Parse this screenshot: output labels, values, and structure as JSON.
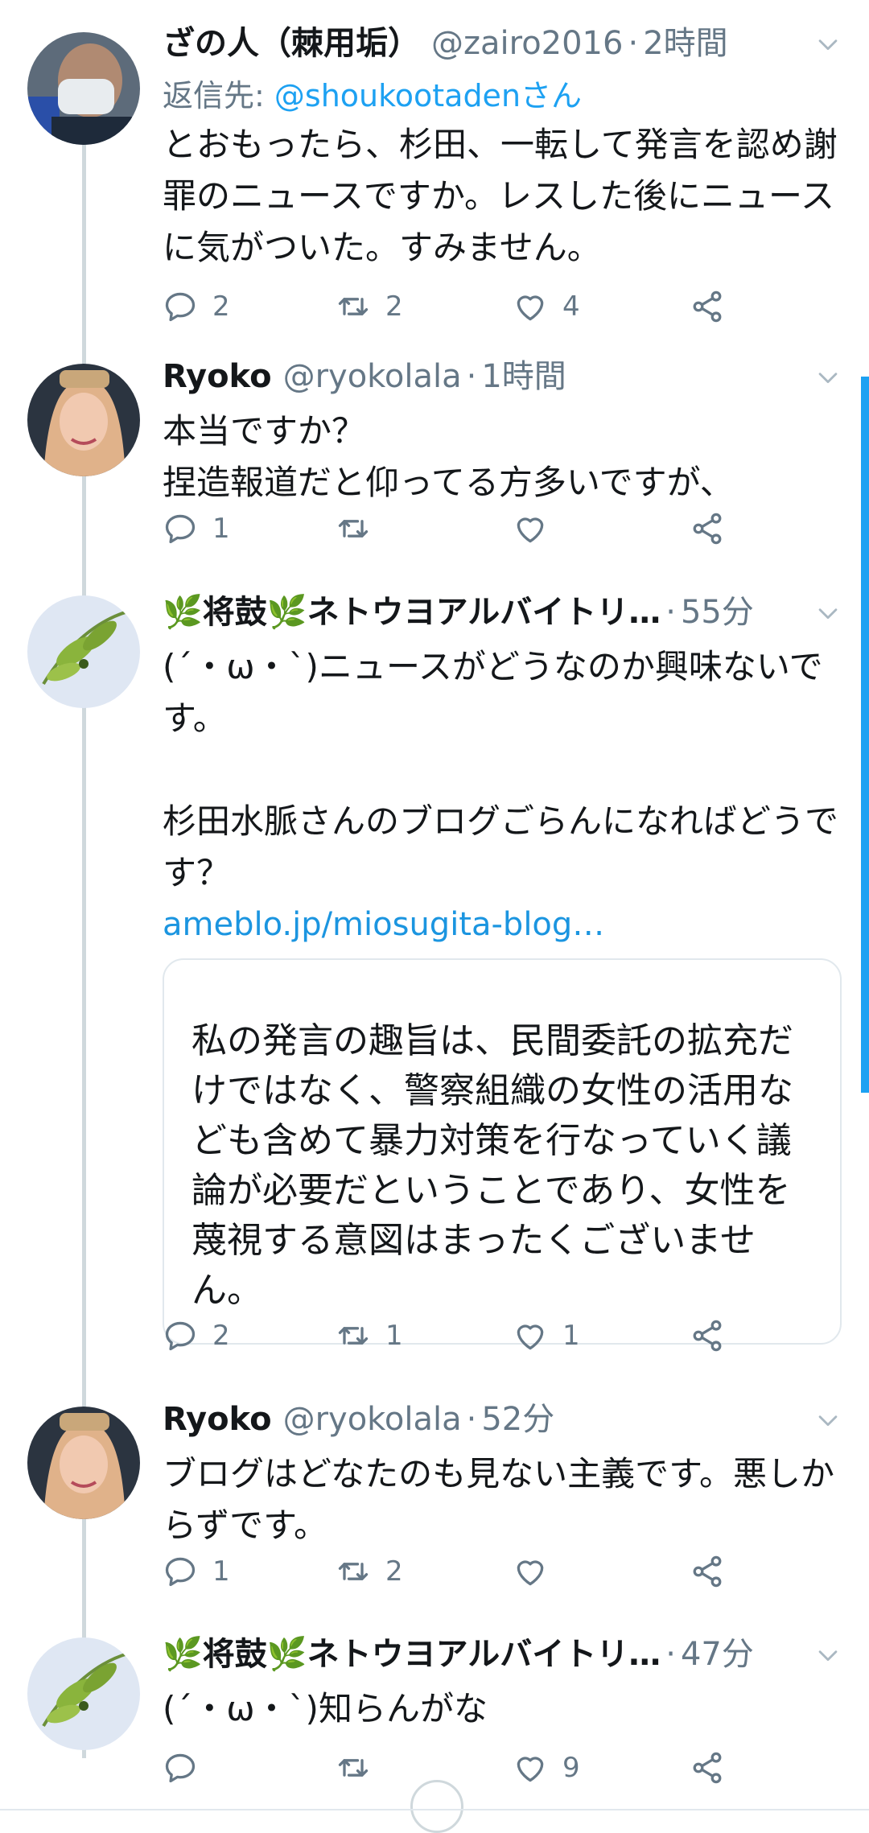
{
  "tweets": [
    {
      "name": "ざの人（棘用垢）",
      "handle": "@zairo2016",
      "time": "2時間",
      "reply_to_label": "返信先: ",
      "reply_to_user": "@shoukootadenさん",
      "text": "とおもったら、杉田、一転して発言を認め謝\n罪のニュースですか。レスした後にニュース\nに気がついた。すみません。",
      "replies": "2",
      "retweets": "2",
      "likes": "4"
    },
    {
      "name": "Ryoko",
      "handle": "@ryokolala",
      "time": "1時間",
      "text": "本当ですか？\n捏造報道だと仰ってる方多いですが、",
      "replies": "1",
      "retweets": "",
      "likes": ""
    },
    {
      "name": "🌿将鼓🌿ネトウヨアルバイトリ…",
      "handle": "",
      "time": "55分",
      "text": "(´・ω・`)ニュースがどうなのか興味ないで\nす。\n\n杉田水脈さんのブログごらんになればどうで\nす？",
      "link": "ameblo.jp/miosugita-blog…",
      "card_text": "ます。\n\n私の発言の趣旨は、民間委託の拡充だ\nけではなく、警察組織の女性の活用な\nども含めて暴力対策を行なっていく議\n論が必要だということであり、女性を\n蔑視する意図はまったくございませ\nん。",
      "replies": "2",
      "retweets": "1",
      "likes": "1"
    },
    {
      "name": "Ryoko",
      "handle": "@ryokolala",
      "time": "52分",
      "text": "ブログはどなたのも見ない主義です。悪しか\nらずです。",
      "replies": "1",
      "retweets": "2",
      "likes": ""
    },
    {
      "name": "🌿将鼓🌿ネトウヨアルバイトリ…",
      "handle": "",
      "time": "47分",
      "text": "(´・ω・`)知らんがな",
      "replies": "",
      "retweets": "",
      "likes": "9"
    }
  ],
  "icons": [
    "reply-icon",
    "retweet-icon",
    "like-icon",
    "share-icon",
    "caret-down-icon"
  ],
  "colors": {
    "link": "#1da1f2",
    "muted": "#657786",
    "thread_line": "#cfd8dc",
    "scrollbar": "#1da1f2"
  }
}
